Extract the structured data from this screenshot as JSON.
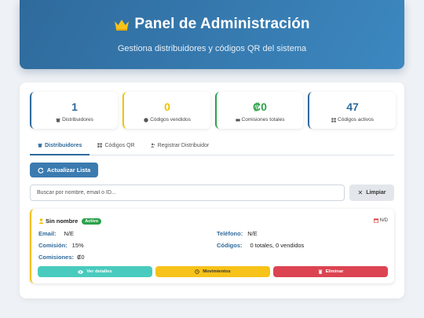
{
  "header": {
    "title": "Panel de Administración",
    "subtitle": "Gestiona distribuidores y códigos QR del sistema",
    "title_icon": "crown-icon"
  },
  "stats": [
    {
      "value": "1",
      "label": "Distribuidores",
      "icon": "store-icon",
      "color": "#2f6a9c"
    },
    {
      "value": "0",
      "label": "Códigos vendidos",
      "icon": "sold-icon",
      "color": "#f2c100"
    },
    {
      "value": "₡0",
      "label": "Comisiones totales",
      "icon": "money-icon",
      "color": "#2ca24b"
    },
    {
      "value": "47",
      "label": "Códigos activos",
      "icon": "qr-icon",
      "color": "#2f6a9c"
    }
  ],
  "tabs": [
    {
      "label": "Distribuidores",
      "icon": "store-icon",
      "active": true
    },
    {
      "label": "Códigos QR",
      "icon": "qr-icon",
      "active": false
    },
    {
      "label": "Registrar Distribuidor",
      "icon": "user-plus-icon",
      "active": false
    }
  ],
  "toolbar": {
    "refresh_label": "Actualizar Lista",
    "search_placeholder": "Buscar por nombre, email o ID...",
    "clear_label": "Limpiar"
  },
  "distributor": {
    "name": "Sin nombre",
    "status": "Activo",
    "date": "N/D",
    "email_key": "Email:",
    "email_value": "N/E",
    "phone_key": "Teléfono:",
    "phone_value": "N/E",
    "commission_key": "Comisión:",
    "commission_value": "15%",
    "codes_key": "Códigos:",
    "codes_value": "0 totales, 0 vendidos",
    "commissions_key": "Comisiones:",
    "commissions_value": "₡0",
    "details_label": "Ver detalles",
    "movements_label": "Movimientos",
    "delete_label": "Eliminar"
  },
  "colors": {
    "primary": "#2f6a9c",
    "accent_yellow": "#f2c100",
    "success": "#2ca24b",
    "danger": "#dc4452",
    "teal": "#48cbbe"
  }
}
